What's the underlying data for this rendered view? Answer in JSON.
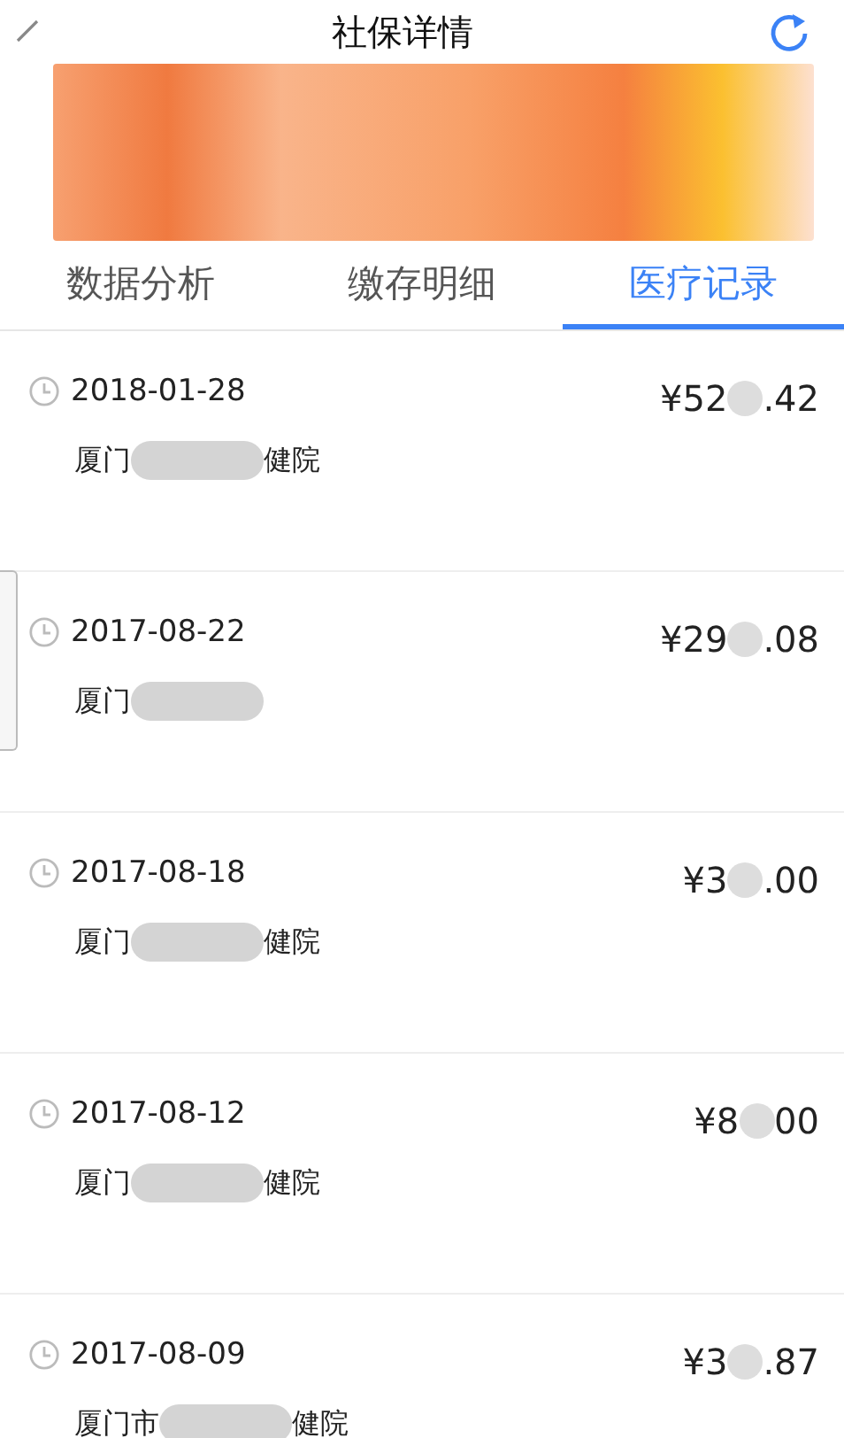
{
  "header": {
    "title": "社保详情"
  },
  "tabs": [
    {
      "label": "数据分析",
      "selected": false
    },
    {
      "label": "缴存明细",
      "selected": false
    },
    {
      "label": "医疗记录",
      "selected": true
    }
  ],
  "records": [
    {
      "date": "2018-01-28",
      "amount_before": "¥52",
      "amount_after": ".42",
      "place_before": "厦门",
      "place_after": "健院"
    },
    {
      "date": "2017-08-22",
      "amount_before": "¥29",
      "amount_after": ".08",
      "place_before": "厦门"
    },
    {
      "date": "2017-08-18",
      "amount_before": "¥3",
      "amount_after": ".00",
      "place_before": "厦门",
      "place_after": "健院"
    },
    {
      "date": "2017-08-12",
      "amount_before": "¥8",
      "amount_after": "00",
      "place_before": "厦门",
      "place_after": "健院"
    },
    {
      "date": "2017-08-09",
      "amount_before": "¥3",
      "amount_after": ".87",
      "place_before": "厦门市",
      "place_after": "健院"
    }
  ]
}
